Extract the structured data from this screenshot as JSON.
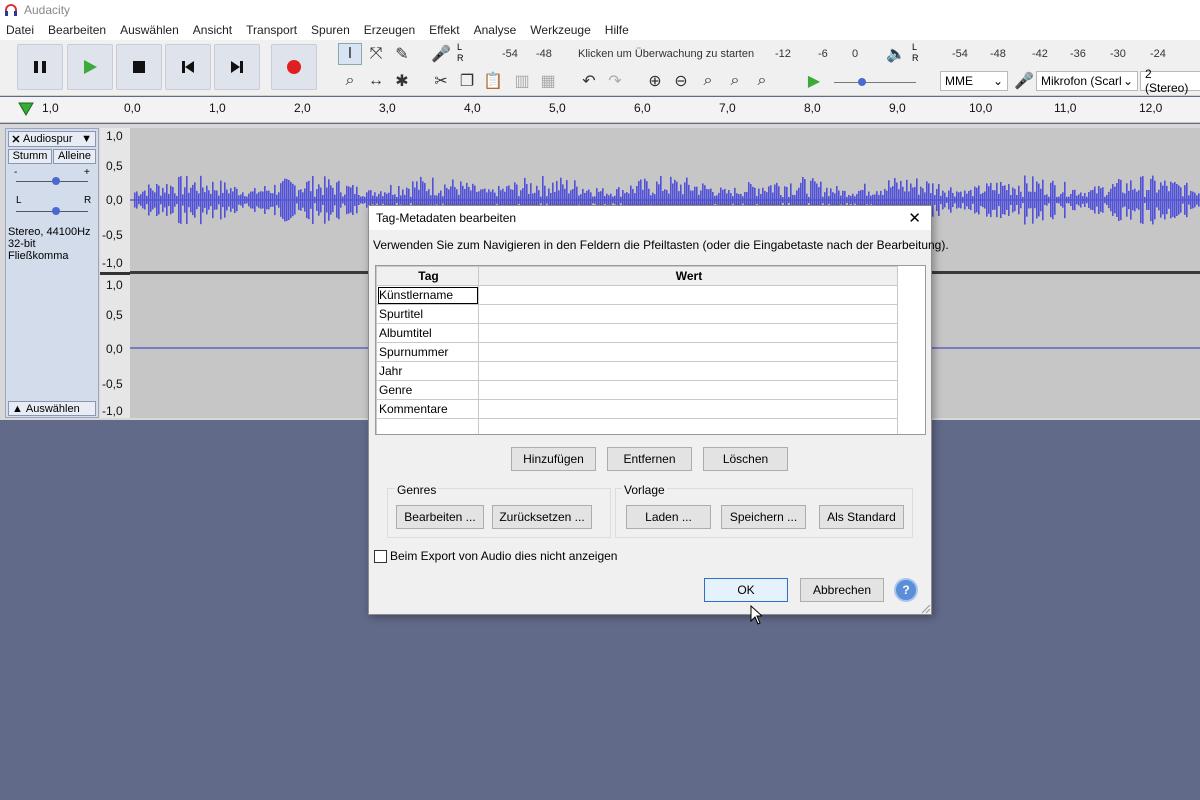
{
  "window": {
    "title": "Audacity"
  },
  "menu": [
    "Datei",
    "Bearbeiten",
    "Auswählen",
    "Ansicht",
    "Transport",
    "Spuren",
    "Erzeugen",
    "Effekt",
    "Analyse",
    "Werkzeuge",
    "Hilfe"
  ],
  "toolbar": {
    "record_meter_labels": [
      "L",
      "R"
    ],
    "record_meter_ticks": [
      "-54",
      "-48",
      "Klicken um Überwachung zu starten",
      "-12",
      "-6",
      "0"
    ],
    "play_meter_labels": [
      "L",
      "R"
    ],
    "play_meter_ticks": [
      "-54",
      "-48",
      "-42",
      "-36",
      "-30",
      "-24"
    ],
    "host": "MME",
    "input_device": "Mikrofon (Scarl",
    "channels": "2 (Stereo)"
  },
  "ruler": {
    "ticks": [
      "1,0",
      "0,0",
      "1,0",
      "2,0",
      "3,0",
      "4,0",
      "5,0",
      "6,0",
      "7,0",
      "8,0",
      "9,0",
      "10,0",
      "11,0",
      "12,0"
    ]
  },
  "track": {
    "name": "Audiospur",
    "mute": "Stumm",
    "solo": "Alleine",
    "pan_left": "L",
    "pan_right": "R",
    "gain_minus": "-",
    "gain_plus": "+",
    "info_line1": "Stereo, 44100Hz",
    "info_line2": "32-bit Fließkomma",
    "select": "Auswählen",
    "scale_top": [
      "1,0",
      "0,5",
      "0,0",
      "-0,5",
      "-1,0"
    ],
    "scale_bottom": [
      "1,0",
      "0,5",
      "0,0",
      "-0,5",
      "-1,0"
    ]
  },
  "dialog": {
    "title": "Tag-Metadaten bearbeiten",
    "instructions": "Verwenden Sie zum Navigieren in den Feldern die Pfeiltasten (oder die Eingabetaste nach der Bearbeitung).",
    "col_tag": "Tag",
    "col_value": "Wert",
    "rows": [
      "Künstlername",
      "Spurtitel",
      "Albumtitel",
      "Spurnummer",
      "Jahr",
      "Genre",
      "Kommentare",
      ""
    ],
    "add": "Hinzufügen",
    "remove": "Entfernen",
    "clear": "Löschen",
    "genres_label": "Genres",
    "genres_edit": "Bearbeiten ...",
    "genres_reset": "Zurücksetzen ...",
    "template_label": "Vorlage",
    "template_load": "Laden ...",
    "template_save": "Speichern ...",
    "template_default": "Als Standard",
    "checkbox_label": "Beim Export von Audio dies nicht anzeigen",
    "ok": "OK",
    "cancel": "Abbrechen",
    "help": "?"
  }
}
